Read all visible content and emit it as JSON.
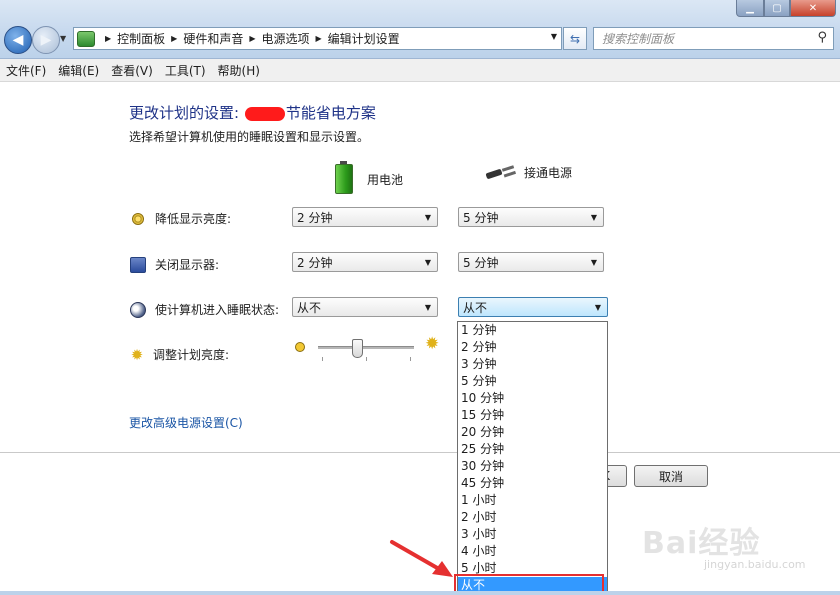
{
  "breadcrumb": [
    "控制面板",
    "硬件和声音",
    "电源选项",
    "编辑计划设置"
  ],
  "search": {
    "placeholder": "搜索控制面板"
  },
  "menu": [
    "文件(F)",
    "编辑(E)",
    "查看(V)",
    "工具(T)",
    "帮助(H)"
  ],
  "page": {
    "title_prefix": "更改计划的设置: ",
    "title_suffix": "节能省电方案",
    "subtitle": "选择希望计算机使用的睡眠设置和显示设置。",
    "col_battery": "用电池",
    "col_plugged": "接通电源"
  },
  "rows": [
    {
      "label": "降低显示亮度:",
      "battery": "2 分钟",
      "plugged": "5 分钟",
      "icon": "dim-icon"
    },
    {
      "label": "关闭显示器:",
      "battery": "2 分钟",
      "plugged": "5 分钟",
      "icon": "monitor-icon"
    },
    {
      "label": "使计算机进入睡眠状态:",
      "battery": "从不",
      "plugged": "从不",
      "icon": "sleep-icon"
    }
  ],
  "brightness": {
    "label": "调整计划亮度:",
    "level": 0.4
  },
  "advanced_link": "更改高级电源设置(C)",
  "buttons": {
    "save_partial": "K",
    "cancel": "取消"
  },
  "dropdown_options": [
    "1 分钟",
    "2 分钟",
    "3 分钟",
    "5 分钟",
    "10 分钟",
    "15 分钟",
    "20 分钟",
    "25 分钟",
    "30 分钟",
    "45 分钟",
    "1 小时",
    "2 小时",
    "3 小时",
    "4 小时",
    "5 小时",
    "从不"
  ],
  "dropdown_selected": "从不",
  "watermark": {
    "text": "Bai经验",
    "url": "jingyan.baidu.com"
  },
  "colors": {
    "title_blue": "#1e3287",
    "link_blue": "#1a55a5",
    "selection": "#3399ff",
    "annotation_red": "#e53030"
  }
}
